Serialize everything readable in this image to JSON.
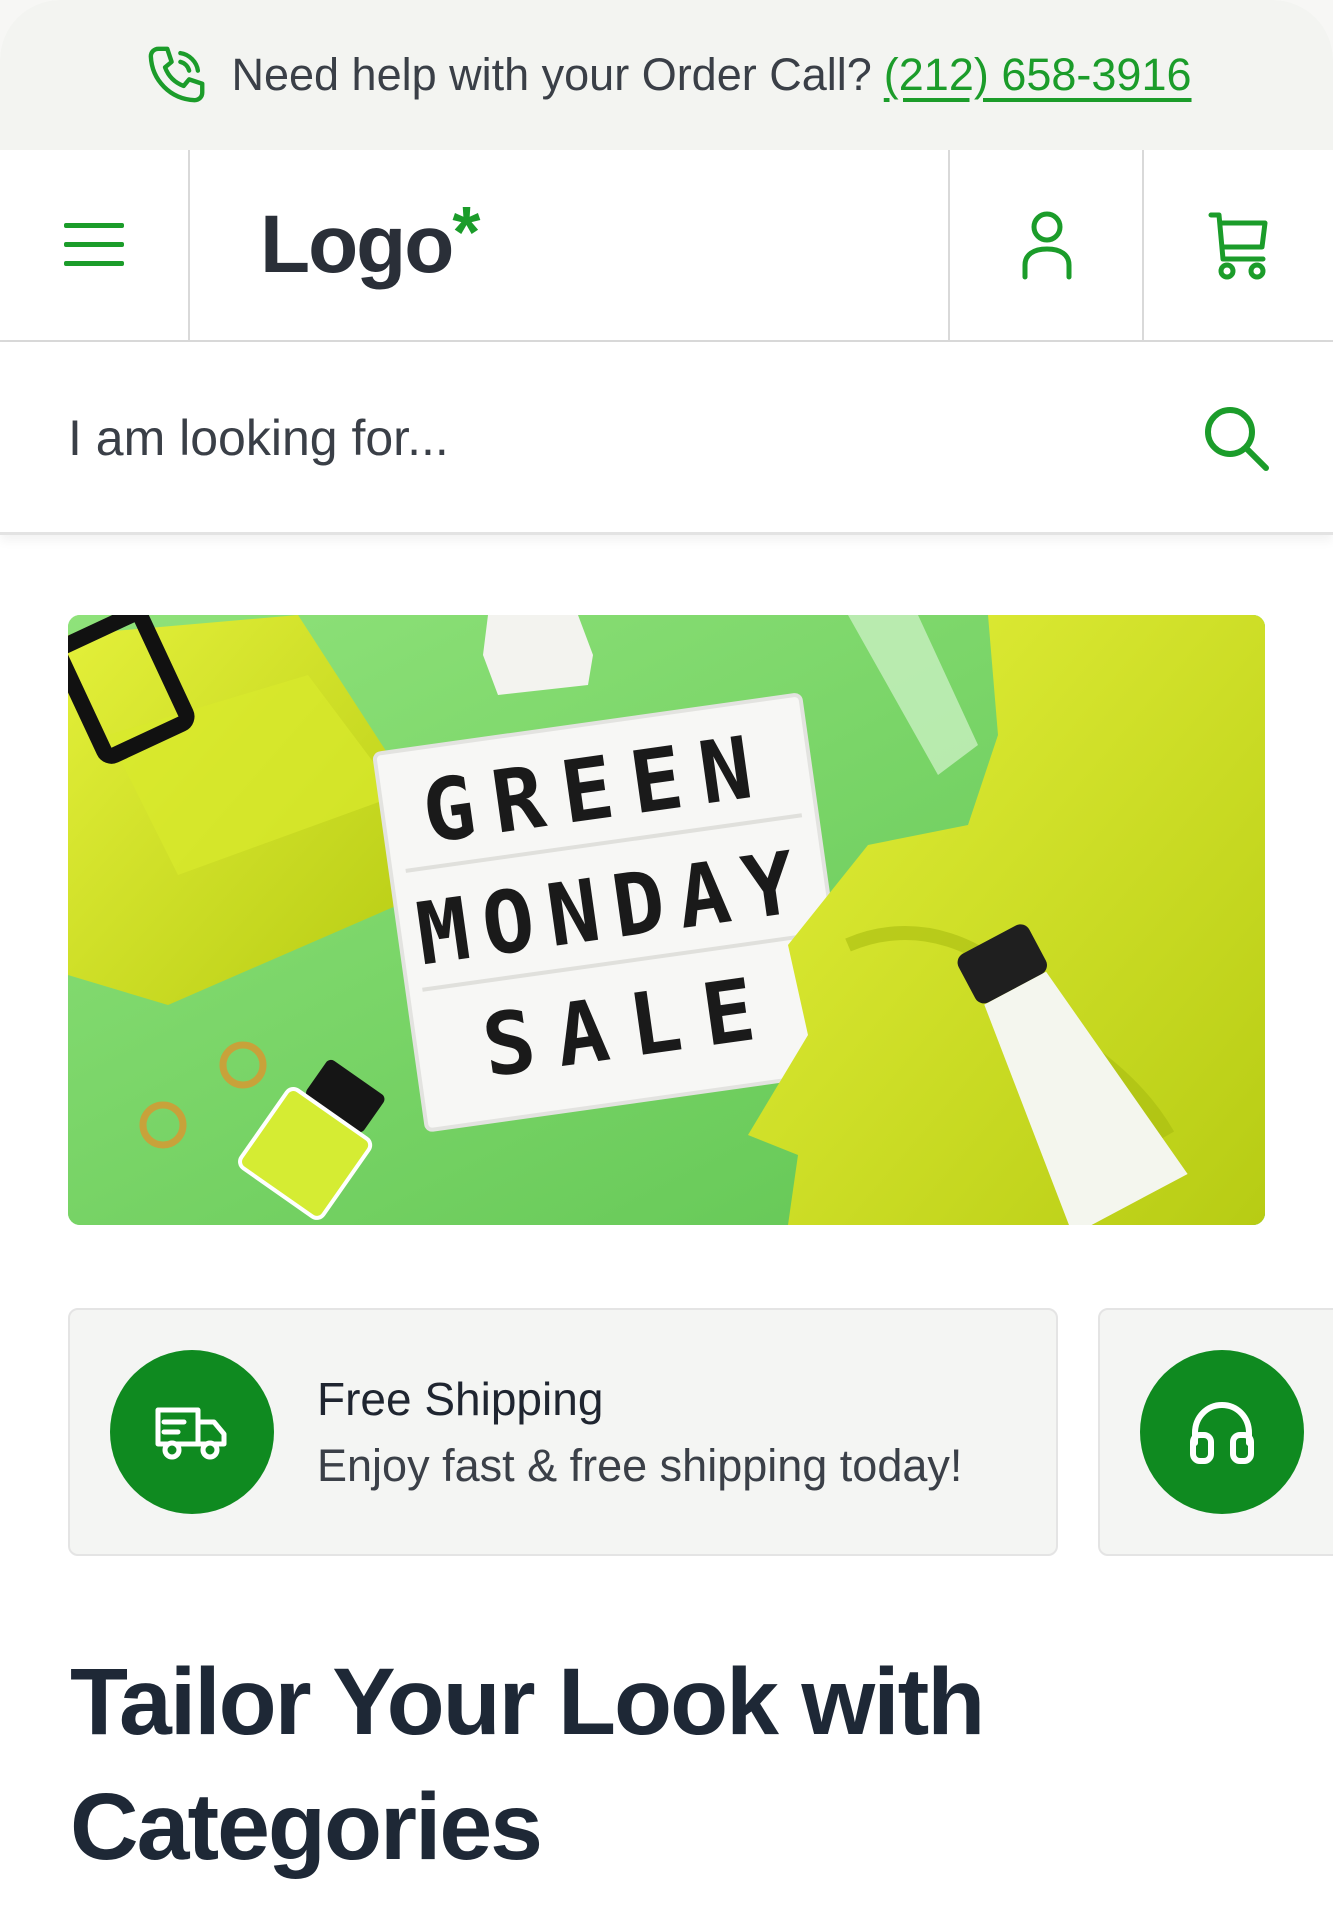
{
  "helpbar": {
    "text": "Need help with your Order Call?",
    "phone": "(212) 658-3916"
  },
  "header": {
    "logo_text": "Logo",
    "logo_mark": "*",
    "icons": [
      "menu-icon",
      "user-icon",
      "cart-icon"
    ]
  },
  "search": {
    "placeholder": "I am looking for..."
  },
  "banner": {
    "lines": [
      "GREEN",
      "MONDAY",
      "SALE"
    ]
  },
  "features": [
    {
      "icon": "truck-icon",
      "title": "Free Shipping",
      "subtitle": "Enjoy fast & free shipping today!"
    },
    {
      "icon": "headphones-icon"
    }
  ],
  "section": {
    "heading": "Tailor Your Look with Categories"
  },
  "colors": {
    "accent": "#1b9c2a",
    "accent_dark": "#0f8a20",
    "text_dark": "#1e2836"
  }
}
